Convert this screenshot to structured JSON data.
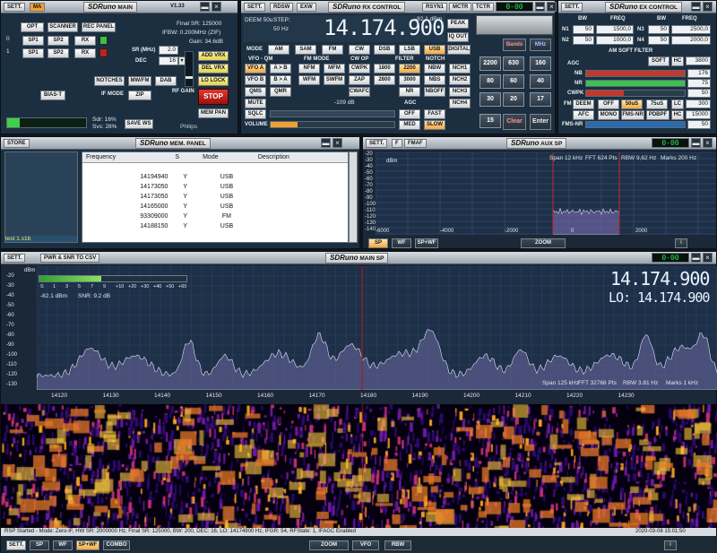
{
  "main": {
    "sett": "SETT.",
    "ma": "MA",
    "logo": "SDRuno",
    "name": "MAIN",
    "version": "V1.33",
    "opt": "OPT",
    "scanner": "SCANNER",
    "rec_panel": "REC PANEL",
    "row0": "0",
    "row1": "1",
    "sp1": "SP1",
    "sp2": "SP2",
    "rx": "RX",
    "final_sr": "Final SR: 125000",
    "ifbw": "IFBW: 0.200MHz (ZIF)",
    "gain": "Gain: 34.6dB",
    "sr_label": "SR (MHz)",
    "sr_value": "2.0",
    "dec_label": "DEC",
    "dec_value": "16",
    "add_vrx": "ADD VRX",
    "del_vrx": "DEL VRX",
    "lo_lock": "LO LOCK",
    "notches": "NOTCHES",
    "mwfm": "MW/FM",
    "dab": "DAB",
    "if_mode": "IF MODE",
    "zip": "ZIP",
    "rf_gain": "RF GAIN",
    "stop": "STOP",
    "mem_pan": "MEM PAN",
    "bias_t": "BIAS-T",
    "sdr_load": "Sdr: 16%",
    "svs_load": "Svs: 28%",
    "save_ws": "SAVE WS",
    "philips": "Philips",
    "cpu_fill": 0.16
  },
  "rx": {
    "logo": "SDRuno",
    "name": "RX CONTROL",
    "sett": "SETT.",
    "rdsw": "RDSW",
    "exw": "EXW",
    "rsyn": "RSYN1",
    "mctr": "MCTR",
    "tctr": "TCTR",
    "deem": "DEEM 50u",
    "step": "STEP:",
    "step_val": "50 Hz",
    "freq": "14.174.900",
    "dbm": "-82.1 dBm",
    "peak": "PEAK",
    "mode": "MODE",
    "modes": [
      "AM",
      "SAM",
      "FM",
      "CW",
      "DSB",
      "LSB",
      "USB",
      "DIGITAL"
    ],
    "iq_out": "IQ OUT",
    "vfo_qm": "VFO - QM",
    "fm_mode": "FM MODE",
    "cw_op": "CW OP",
    "filter": "FILTER",
    "notch": "NOTCH",
    "vfo_a": "VFO A",
    "a_b": "A > B",
    "nfm": "NFM",
    "mfm": "MFM",
    "cwpk": "CWPK",
    "f1800": "1800",
    "f2200": "2200",
    "nbw": "NBW",
    "nch1": "NCH1",
    "vfo_b": "VFO B",
    "b_a": "B > A",
    "wfm": "WFM",
    "swfm": "SWFM",
    "zap": "ZAP",
    "f2800": "2800",
    "f3000": "3000",
    "nbs": "NBS",
    "nch2": "NCH2",
    "qms": "QMS",
    "qmr": "QMR",
    "cwafc": "CWAFC",
    "nr": "NR",
    "nboff": "NBOFF",
    "nch3": "NCH3",
    "mute": "MUTE",
    "squelch_db": "-109 dB",
    "nch4": "NCH4",
    "sqlc": "SQLC",
    "agc": "AGC",
    "off": "OFF",
    "fast": "FAST",
    "volume": "VOLUME",
    "med": "MED",
    "slow": "SLOW",
    "bands": "Bands",
    "mhz": "MHz",
    "keys": [
      "2200",
      "630",
      "160",
      "80",
      "60",
      "40",
      "30",
      "20",
      "17",
      "15"
    ],
    "clear": "Clear",
    "enter": "Enter",
    "vol_fill": 0.22
  },
  "ex": {
    "logo": "SDRuno",
    "name": "EX CONTROL",
    "sett": "SETT.",
    "bw": "BW",
    "freq": "FREQ",
    "n1": "N1",
    "n2": "N2",
    "n3": "N3",
    "n4": "N4",
    "n1_bw": "50",
    "n1_f": "1500,0",
    "n2_bw": "50",
    "n2_f": "1000,0",
    "n3_bw": "50",
    "n3_f": "2500,0",
    "n4_bw": "50",
    "n4_f": "2000,0",
    "am_soft": "AM SOFT FILTER",
    "soft": "SOFT",
    "hc": "HC",
    "hc_val": "3800",
    "agc": "AGC",
    "nb": "NB",
    "nb_val": "176",
    "nr": "NR",
    "nr_val": "75",
    "cwpk": "CWPK",
    "cwpk_val": "50",
    "fm": "FM",
    "deem": "DEEM",
    "off": "OFF",
    "s50us": "50uS",
    "s75us": "75uS",
    "lc": "LC",
    "lc_val": "300",
    "afc": "AFC",
    "mono": "MONO",
    "fms_nr": "FMS-NR",
    "pdbpf": "PDBPF",
    "hc2": "HC",
    "hc2_val": "15000",
    "fms_nr2": "FMS-NR",
    "fms_val": "50"
  },
  "mem": {
    "store": "STORE",
    "logo": "SDRuno",
    "name": "MEM. PANEL",
    "columns": [
      "Frequency",
      "S",
      "Mode",
      "Description"
    ],
    "rows": [
      [
        "14194940",
        "Y",
        "USB",
        ""
      ],
      [
        "14173050",
        "Y",
        "USB",
        ""
      ],
      [
        "14173050",
        "Y",
        "USB",
        ""
      ],
      [
        "14165000",
        "Y",
        "USB",
        ""
      ],
      [
        "93309000",
        "Y",
        "FM",
        ""
      ],
      [
        "14188150",
        "Y",
        "USB",
        ""
      ]
    ],
    "file": "test 1.s1b"
  },
  "aux": {
    "sett": "SETT.",
    "f": "F",
    "fmaf": "FMAF",
    "logo": "SDRuno",
    "name": "AUX SP",
    "dbm": "dBm",
    "yticks": [
      "-20",
      "-30",
      "-40",
      "-50",
      "-60",
      "-70",
      "-80",
      "-90",
      "-100",
      "-110",
      "-120",
      "-130",
      "-140"
    ],
    "span": "Span 12 kHz",
    "fft": "FFT 624 Pts",
    "rbw": "RBW 9,62 Hz",
    "marks": "Marks 200 Hz",
    "xticks": [
      "-6000",
      "-4000",
      "-2000",
      "0",
      "2000"
    ],
    "sp": "SP",
    "wf": "WF",
    "spwf": "SP+WF",
    "zoom": "ZOOM",
    "i": "i"
  },
  "mainsp": {
    "sett": "SETT.",
    "pwr": "PWR & SNR TO CSV",
    "logo": "SDRuno",
    "name": "MAIN SP",
    "dbm": "dBm",
    "yticks": [
      "-20",
      "-30",
      "-40",
      "-50",
      "-60",
      "-70",
      "-80",
      "-90",
      "-100",
      "-110",
      "-120",
      "-130"
    ],
    "smeter_ticks": [
      "S",
      "1",
      "3",
      "5",
      "7",
      "9",
      "+10",
      "+20",
      "+30",
      "+40",
      "+50",
      "+60"
    ],
    "level": "-82.1 dBm",
    "snr": "SNR: 9.2 dB",
    "freq": "14.174.900",
    "lo": "LO:  14.174.900",
    "span": "Span 125 kHz",
    "fft": "FFT 32768 Pts",
    "rbw": "RBW 3.81 Hz",
    "marks": "Marks 1 kHz",
    "xticks": [
      "14120",
      "14130",
      "14140",
      "14150",
      "14160",
      "14170",
      "14180",
      "14190",
      "14200",
      "14210",
      "14220",
      "14230"
    ]
  },
  "status": {
    "text": "RSP Started - Mode: Zero-IF, HW SR: 2000000 Hz, Final SR: 125000, BW: 200, DEC: 16, LO: 14174900 Hz, IFGR: 54, RFState: 1, IFAGC Enabled",
    "time": "2020-03-08 15:01:50",
    "sett": "SETT.",
    "sp": "SP",
    "wf": "WF",
    "spwf": "SP+WF",
    "combo": "COMBO",
    "zoom": "ZOOM",
    "vfo": "VFO",
    "rbw": "RBW",
    "i": "i"
  },
  "colors": {
    "panel": "#1c2f40",
    "spectrum": "#1f2f4a",
    "accent": "#f0a030",
    "stop": "#c02020"
  }
}
